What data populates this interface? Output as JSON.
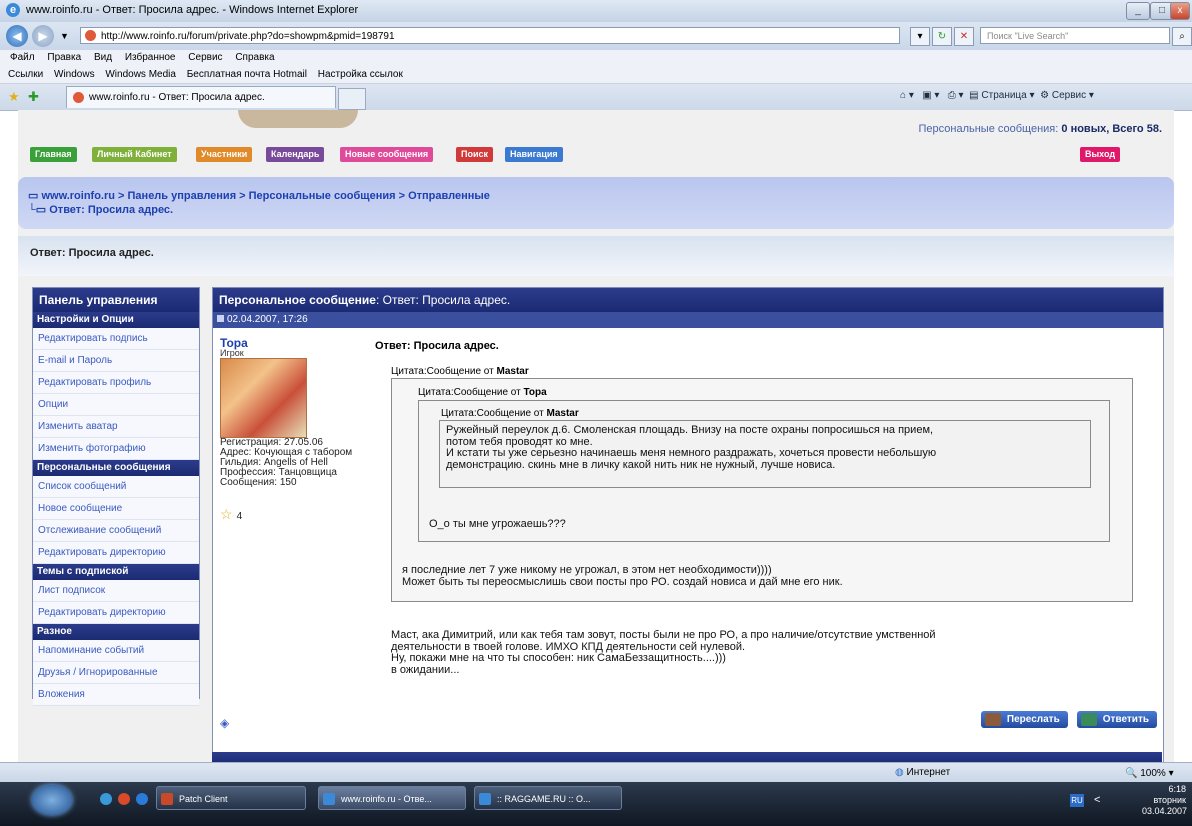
{
  "window": {
    "title": "www.roinfo.ru - Ответ: Просила адрес. - Windows Internet Explorer"
  },
  "addressbar": {
    "url": "http://www.roinfo.ru/forum/private.php?do=showpm&pmid=198791",
    "search_placeholder": "Поиск \"Live Search\""
  },
  "menu": [
    "Файл",
    "Правка",
    "Вид",
    "Избранное",
    "Сервис",
    "Справка"
  ],
  "links": {
    "label": "Ссылки",
    "items": [
      "Windows",
      "Windows Media",
      "Бесплатная почта Hotmail",
      "Настройка ссылок"
    ]
  },
  "tab": {
    "title": "www.roinfo.ru - Ответ: Просила адрес."
  },
  "command_bar": {
    "page": "Страница",
    "tools": "Сервис"
  },
  "forum": {
    "pm_status_label": "Персональные сообщения:",
    "pm_status_value": "0 новых, Всего 58.",
    "nav": [
      {
        "label": "Главная",
        "color": "#3aa03a"
      },
      {
        "label": "Личный Кабинет",
        "color": "#7fb03a"
      },
      {
        "label": "Участники",
        "color": "#e08a2a"
      },
      {
        "label": "Календарь",
        "color": "#7a4a9a"
      },
      {
        "label": "Новые сообщения",
        "color": "#e04a9a"
      },
      {
        "label": "Поиск",
        "color": "#d03a3a"
      },
      {
        "label": "Навигация",
        "color": "#3a7ad0"
      }
    ],
    "logout": "Выход",
    "breadcrumb": {
      "line1": "www.roinfo.ru > Панель управления > Персональные сообщения > Отправленные",
      "line2": "Ответ: Просила адрес."
    },
    "page_title": "Ответ: Просила адрес."
  },
  "sidebar": {
    "title": "Панель управления",
    "sections": [
      {
        "title": "Настройки и Опции",
        "items": [
          "Редактировать подпись",
          "E-mail и Пароль",
          "Редактировать профиль",
          "Опции",
          "Изменить аватар",
          "Изменить фотографию"
        ]
      },
      {
        "title": "Персональные сообщения",
        "items": [
          "Список сообщений",
          "Новое сообщение",
          "Отслеживание сообщений",
          "Редактировать директорию"
        ]
      },
      {
        "title": "Темы с подпиской",
        "items": [
          "Лист подписок",
          "Редактировать директорию"
        ]
      },
      {
        "title": "Разное",
        "items": [
          "Напоминание событий",
          "Друзья / Игнорированные",
          "Вложения"
        ]
      }
    ]
  },
  "message": {
    "header_label": "Персональное сообщение",
    "header_title": ": Ответ: Просила адрес.",
    "date": "02.04.2007, 17:26",
    "user": {
      "name": "Topa",
      "role": "Игрок",
      "registration": "Регистрация: 27.05.06",
      "address": "Адрес: Кочующая с табором",
      "guild": "Гильдия: Angells of Hell",
      "profession": "Профессия: Танцовщица",
      "posts": "Сообщения: 150",
      "rating": "4"
    },
    "title": "Ответ: Просила адрес.",
    "quote1_label": "Цитата:Сообщение от ",
    "quote1_author": "Mastar",
    "quote2_label": "Цитата:Сообщение от ",
    "quote2_author": "Topa",
    "quote3_label": "Цитата:Сообщение от ",
    "quote3_author": "Mastar",
    "quote3_text": [
      "Ружейный переулок д.6. Смоленская площадь. Внизу на посте охраны попросишься на прием,",
      "потом тебя проводят ко мне.",
      "И кстати ты уже серьезно начинаешь меня немного раздражать, хочеться провести небольшую",
      "демонстрацию. скинь мне в личку какой нить ник не нужный, лучше новиса."
    ],
    "quote2_text": "О_о ты мне угрожаешь???",
    "quote1_text": [
      "я последние лет 7 уже никому не угрожал, в этом нет необходимости))))",
      "Может быть ты переосмыслишь свои посты про РО. создай новиса и дай мне его ник."
    ],
    "body": [
      "Маст, ака Димитрий, или как тебя там зовут, посты были не про РО, а про наличие/отсутствие умственной",
      "деятельности в твоей голове. ИМХО КПД деятельности сей нулевой.",
      "Ну, покажи мне на что ты способен: ник СамаБеззащитность....)))",
      "в ожидании..."
    ],
    "forward_button": "Переслать",
    "reply_button": "Ответить"
  },
  "statusbar": {
    "zone": "Интернет",
    "zoom": "100%"
  },
  "taskbar": {
    "tasks": [
      "Patch Client",
      "www.roinfo.ru - Отве...",
      ":: RAGGAME.RU :: О..."
    ],
    "lang": "RU",
    "time": "6:18",
    "day": "вторник",
    "date": "03.04.2007"
  }
}
